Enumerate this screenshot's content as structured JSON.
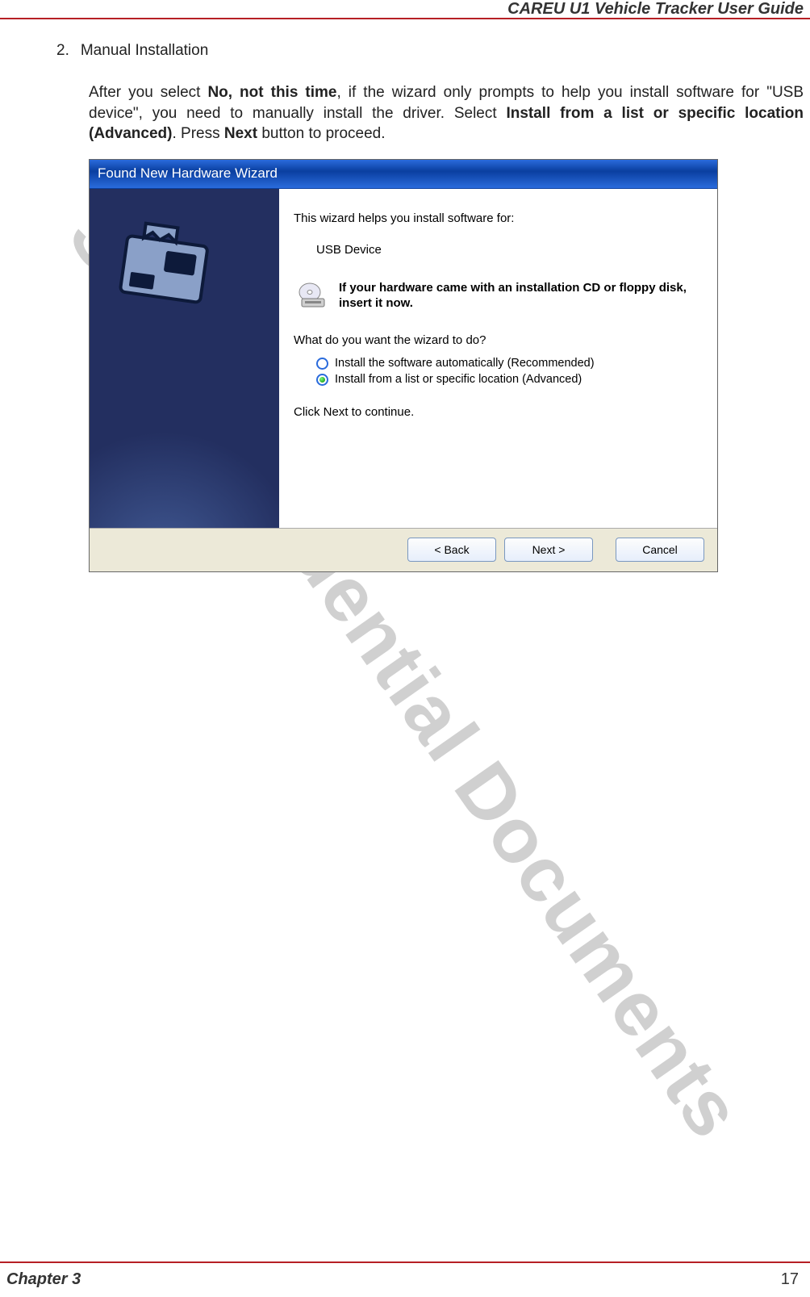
{
  "header": {
    "title": "CAREU U1 Vehicle Tracker User Guide"
  },
  "section": {
    "number": "2.",
    "title": "Manual Installation",
    "para_pre": "After you select ",
    "bold1": "No, not this time",
    "para_mid": ", if the wizard only prompts to help you install software for \"USB device\", you need to manually install the driver. Select ",
    "bold2": "Install from a list or specific location (Advanced)",
    "para_mid2": ". Press ",
    "bold3": "Next",
    "para_end": " button to proceed."
  },
  "wizard": {
    "title": "Found New Hardware Wizard",
    "intro": "This wizard helps you install software for:",
    "device": "USB Device",
    "cd_text": "If your hardware came with an installation CD or floppy disk, insert it now.",
    "question": "What do you want the wizard to do?",
    "option1": "Install the software automatically (Recommended)",
    "option2": "Install from a list or specific location (Advanced)",
    "click_next": "Click Next to continue.",
    "buttons": {
      "back": "< Back",
      "next": "Next >",
      "cancel": "Cancel"
    }
  },
  "watermark": "S&T Confidential Documents",
  "footer": {
    "chapter": "Chapter 3",
    "page": "17"
  }
}
